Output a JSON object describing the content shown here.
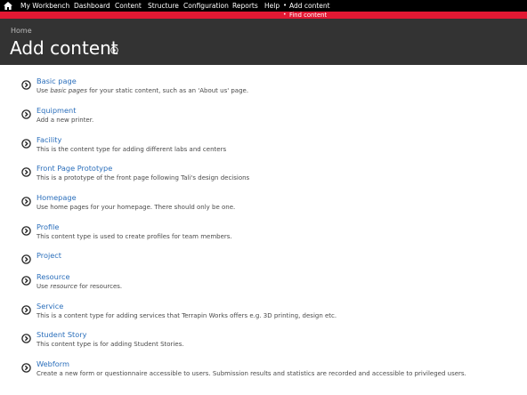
{
  "toolbar": {
    "items": [
      "My Workbench",
      "Dashboard",
      "Content",
      "Structure",
      "Configuration",
      "Reports",
      "Help",
      "Add content"
    ],
    "active_sub_item": "Find content"
  },
  "header": {
    "breadcrumb": "Home",
    "title": "Add content"
  },
  "content_types": [
    {
      "title": "Basic page",
      "desc_before": "Use ",
      "desc_em": "basic pages",
      "desc_after": " for your static content, such as an 'About us' page."
    },
    {
      "title": "Equipment",
      "desc_before": "Add a new printer.",
      "desc_em": "",
      "desc_after": ""
    },
    {
      "title": "Facility",
      "desc_before": "This is the content type for adding different labs and centers",
      "desc_em": "",
      "desc_after": ""
    },
    {
      "title": "Front Page Prototype",
      "desc_before": "This is a prototype of the front page following Tali's design decisions",
      "desc_em": "",
      "desc_after": ""
    },
    {
      "title": "Homepage",
      "desc_before": "Use home pages for your homepage. There should only be one.",
      "desc_em": "",
      "desc_after": ""
    },
    {
      "title": "Profile",
      "desc_before": "This content type is used to create profiles for team members.",
      "desc_em": "",
      "desc_after": ""
    },
    {
      "title": "Project",
      "desc_before": "",
      "desc_em": "",
      "desc_after": ""
    },
    {
      "title": "Resource",
      "desc_before": "Use ",
      "desc_em": "resource",
      "desc_after": " for resources."
    },
    {
      "title": "Service",
      "desc_before": "This is a content type for adding services that Terrapin Works offers e.g. 3D printing, design etc.",
      "desc_em": "",
      "desc_after": ""
    },
    {
      "title": "Student Story",
      "desc_before": "This content type is for adding Student Stories.",
      "desc_em": "",
      "desc_after": ""
    },
    {
      "title": "Webform",
      "desc_before": "Create a new form or questionnaire accessible to users. Submission results and statistics are recorded and accessible to privileged users.",
      "desc_em": "",
      "desc_after": ""
    }
  ],
  "icons": {
    "home": "home-icon",
    "help": "help-circle-icon",
    "item_arrow": "circle-arrow-right-icon"
  },
  "colors": {
    "toolbar": "#000000",
    "accent_stripe": "#e21833",
    "header": "#333333",
    "link": "#2a6ebb",
    "description": "#4a4a4a"
  }
}
